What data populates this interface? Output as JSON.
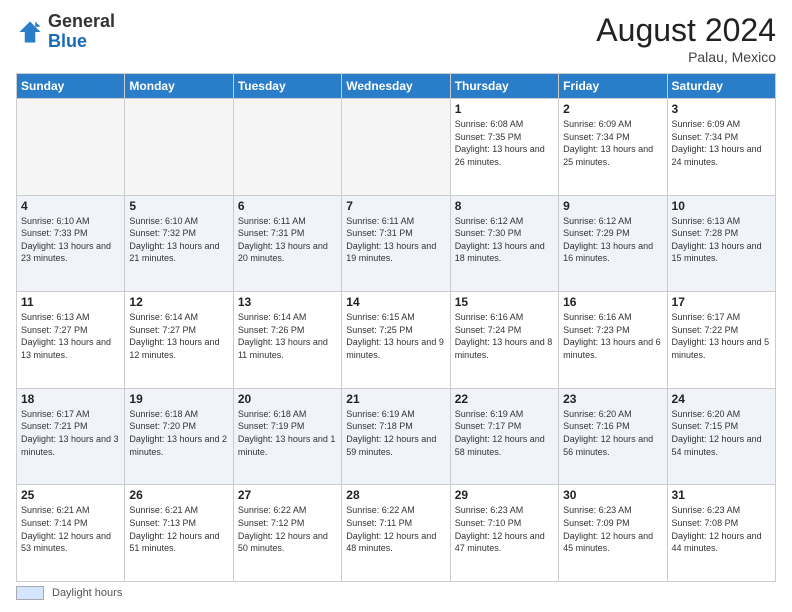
{
  "header": {
    "logo_general": "General",
    "logo_blue": "Blue",
    "month_year": "August 2024",
    "location": "Palau, Mexico"
  },
  "footer": {
    "swatch_label": "Daylight hours"
  },
  "weekdays": [
    "Sunday",
    "Monday",
    "Tuesday",
    "Wednesday",
    "Thursday",
    "Friday",
    "Saturday"
  ],
  "weeks": [
    [
      {
        "day": "",
        "info": ""
      },
      {
        "day": "",
        "info": ""
      },
      {
        "day": "",
        "info": ""
      },
      {
        "day": "",
        "info": ""
      },
      {
        "day": "1",
        "info": "Sunrise: 6:08 AM\nSunset: 7:35 PM\nDaylight: 13 hours and 26 minutes."
      },
      {
        "day": "2",
        "info": "Sunrise: 6:09 AM\nSunset: 7:34 PM\nDaylight: 13 hours and 25 minutes."
      },
      {
        "day": "3",
        "info": "Sunrise: 6:09 AM\nSunset: 7:34 PM\nDaylight: 13 hours and 24 minutes."
      }
    ],
    [
      {
        "day": "4",
        "info": "Sunrise: 6:10 AM\nSunset: 7:33 PM\nDaylight: 13 hours and 23 minutes."
      },
      {
        "day": "5",
        "info": "Sunrise: 6:10 AM\nSunset: 7:32 PM\nDaylight: 13 hours and 21 minutes."
      },
      {
        "day": "6",
        "info": "Sunrise: 6:11 AM\nSunset: 7:31 PM\nDaylight: 13 hours and 20 minutes."
      },
      {
        "day": "7",
        "info": "Sunrise: 6:11 AM\nSunset: 7:31 PM\nDaylight: 13 hours and 19 minutes."
      },
      {
        "day": "8",
        "info": "Sunrise: 6:12 AM\nSunset: 7:30 PM\nDaylight: 13 hours and 18 minutes."
      },
      {
        "day": "9",
        "info": "Sunrise: 6:12 AM\nSunset: 7:29 PM\nDaylight: 13 hours and 16 minutes."
      },
      {
        "day": "10",
        "info": "Sunrise: 6:13 AM\nSunset: 7:28 PM\nDaylight: 13 hours and 15 minutes."
      }
    ],
    [
      {
        "day": "11",
        "info": "Sunrise: 6:13 AM\nSunset: 7:27 PM\nDaylight: 13 hours and 13 minutes."
      },
      {
        "day": "12",
        "info": "Sunrise: 6:14 AM\nSunset: 7:27 PM\nDaylight: 13 hours and 12 minutes."
      },
      {
        "day": "13",
        "info": "Sunrise: 6:14 AM\nSunset: 7:26 PM\nDaylight: 13 hours and 11 minutes."
      },
      {
        "day": "14",
        "info": "Sunrise: 6:15 AM\nSunset: 7:25 PM\nDaylight: 13 hours and 9 minutes."
      },
      {
        "day": "15",
        "info": "Sunrise: 6:16 AM\nSunset: 7:24 PM\nDaylight: 13 hours and 8 minutes."
      },
      {
        "day": "16",
        "info": "Sunrise: 6:16 AM\nSunset: 7:23 PM\nDaylight: 13 hours and 6 minutes."
      },
      {
        "day": "17",
        "info": "Sunrise: 6:17 AM\nSunset: 7:22 PM\nDaylight: 13 hours and 5 minutes."
      }
    ],
    [
      {
        "day": "18",
        "info": "Sunrise: 6:17 AM\nSunset: 7:21 PM\nDaylight: 13 hours and 3 minutes."
      },
      {
        "day": "19",
        "info": "Sunrise: 6:18 AM\nSunset: 7:20 PM\nDaylight: 13 hours and 2 minutes."
      },
      {
        "day": "20",
        "info": "Sunrise: 6:18 AM\nSunset: 7:19 PM\nDaylight: 13 hours and 1 minute."
      },
      {
        "day": "21",
        "info": "Sunrise: 6:19 AM\nSunset: 7:18 PM\nDaylight: 12 hours and 59 minutes."
      },
      {
        "day": "22",
        "info": "Sunrise: 6:19 AM\nSunset: 7:17 PM\nDaylight: 12 hours and 58 minutes."
      },
      {
        "day": "23",
        "info": "Sunrise: 6:20 AM\nSunset: 7:16 PM\nDaylight: 12 hours and 56 minutes."
      },
      {
        "day": "24",
        "info": "Sunrise: 6:20 AM\nSunset: 7:15 PM\nDaylight: 12 hours and 54 minutes."
      }
    ],
    [
      {
        "day": "25",
        "info": "Sunrise: 6:21 AM\nSunset: 7:14 PM\nDaylight: 12 hours and 53 minutes."
      },
      {
        "day": "26",
        "info": "Sunrise: 6:21 AM\nSunset: 7:13 PM\nDaylight: 12 hours and 51 minutes."
      },
      {
        "day": "27",
        "info": "Sunrise: 6:22 AM\nSunset: 7:12 PM\nDaylight: 12 hours and 50 minutes."
      },
      {
        "day": "28",
        "info": "Sunrise: 6:22 AM\nSunset: 7:11 PM\nDaylight: 12 hours and 48 minutes."
      },
      {
        "day": "29",
        "info": "Sunrise: 6:23 AM\nSunset: 7:10 PM\nDaylight: 12 hours and 47 minutes."
      },
      {
        "day": "30",
        "info": "Sunrise: 6:23 AM\nSunset: 7:09 PM\nDaylight: 12 hours and 45 minutes."
      },
      {
        "day": "31",
        "info": "Sunrise: 6:23 AM\nSunset: 7:08 PM\nDaylight: 12 hours and 44 minutes."
      }
    ]
  ]
}
